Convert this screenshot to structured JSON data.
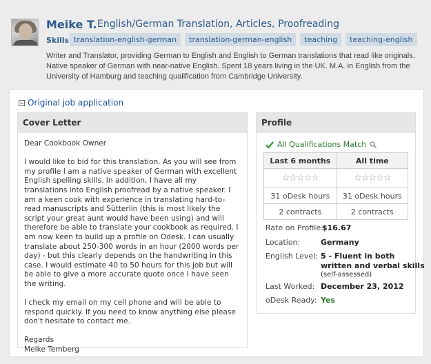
{
  "header": {
    "name": "Meike T.",
    "title": "English/German Translation, Articles, Proofreading",
    "skills_label": "Skills:",
    "skills": [
      "translation-english-german",
      "translation-german-english",
      "teaching",
      "teaching-english"
    ],
    "bio": "Writer and Translator, providing German to English and English to German translations that read like originals. Native speaker of German with near-native English. Spent 18 years living in the UK. M.A. in English from the University of Hamburg and teaching qualification from Cambridge University."
  },
  "original_link": "Original job application",
  "cover_letter": {
    "heading": "Cover Letter",
    "greeting": "Dear Cookbook Owner",
    "paragraph1": "I would like to bid for this translation. As you will see from my profile I am a native speaker of German with excellent English spelling skills. In addition, I have all my translations into English proofread by a native speaker. I am a keen cook with experience in translating hard-to-read manuscripts and Sütterlin (this is most likely the script your great aunt would have been using) and will therefore be able to translate your cookbook as required. I am now keen to build up a profile on Odesk. I can usually translate about 250-300 words in an hour (2000 words per day) - but this clearly depends on the handwriting in this case. I would estimate 40 to 50 hours for this job but will be able to give a more accurate quote once I have seen the writing.",
    "paragraph2": "I check my email on my cell phone and will be able to respond quickly. If you need to know anything else please don't hesitate to contact me.",
    "closing": "Regards",
    "signature": "Meike Temberg"
  },
  "profile": {
    "heading": "Profile",
    "qualifications": "All Qualifications Match",
    "columns": [
      "Last 6 months",
      "All time"
    ],
    "stars": [
      "☆☆☆☆☆",
      "☆☆☆☆☆"
    ],
    "hours": [
      "31 oDesk hours",
      "31 oDesk hours"
    ],
    "contracts": [
      "2 contracts",
      "2 contracts"
    ],
    "rate_label": "Rate on Profile:",
    "rate_value": "$16.67",
    "location_label": "Location:",
    "location_value": "Germany",
    "english_label": "English Level:",
    "english_value_line1": "5 - Fluent in both",
    "english_value_line2": "written and verbal skills",
    "english_note": "(self-assessed)",
    "last_worked_label": "Last Worked:",
    "last_worked_value": "December 23, 2012",
    "ready_label": "oDesk Ready:",
    "ready_value": "Yes"
  },
  "colors": {
    "accent": "#2d5a8a",
    "link": "#1a4fa0",
    "success": "#2d7a2d",
    "skill_bg": "#d0dbe6"
  }
}
